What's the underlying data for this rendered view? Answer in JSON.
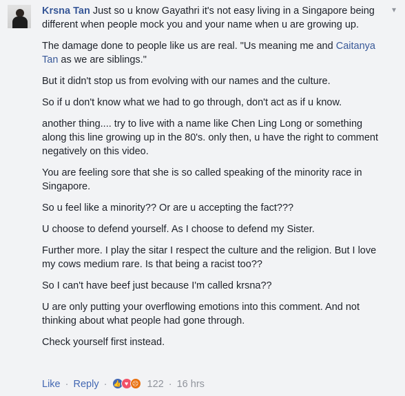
{
  "comment": {
    "author": "Krsna Tan",
    "first_line": " Just so u know Gayathri it's not easy living in a Singapore being different when people mock you and your name when u are growing up.",
    "paragraphs": [
      {
        "before": "The damage done to people like us are real. \"Us meaning me and ",
        "mention": "Caitanya Tan",
        "after": " as we are siblings.\""
      },
      {
        "before": "But it didn't stop us from evolving with our names and the culture."
      },
      {
        "before": "So if u don't know what we had to go through, don't act as if u know."
      },
      {
        "before": "another thing.... try to live with a name like Chen Ling Long or something along this line growing up in the 80's. only then, u have the right to comment negatively on this video."
      },
      {
        "before": "You are feeling sore that she is so called speaking of the minority race in Singapore."
      },
      {
        "before": "So u feel like a minority?? Or are u accepting the fact???"
      },
      {
        "before": "U choose to defend yourself. As I choose to defend my Sister."
      },
      {
        "before": "Further more. I play the sitar I respect the culture and the religion. But I love my cows medium rare. Is that being a racist too??"
      },
      {
        "before": "So I can't have beef just because I'm called krsna??"
      },
      {
        "before": "U are only putting your overflowing emotions into this comment. And not thinking about what people had gone through."
      },
      {
        "before": "Check yourself first instead."
      }
    ]
  },
  "actions": {
    "like": "Like",
    "reply": "Reply",
    "separator": "·",
    "reaction_count": "122",
    "timestamp": "16 hrs"
  },
  "icons": {
    "options": "chevron-down-icon",
    "reactions": [
      "like-reaction-icon",
      "love-reaction-icon",
      "angry-reaction-icon"
    ]
  },
  "colors": {
    "author": "#385898",
    "link": "#4267b2",
    "meta": "#90949c",
    "background": "#f2f3f5"
  }
}
